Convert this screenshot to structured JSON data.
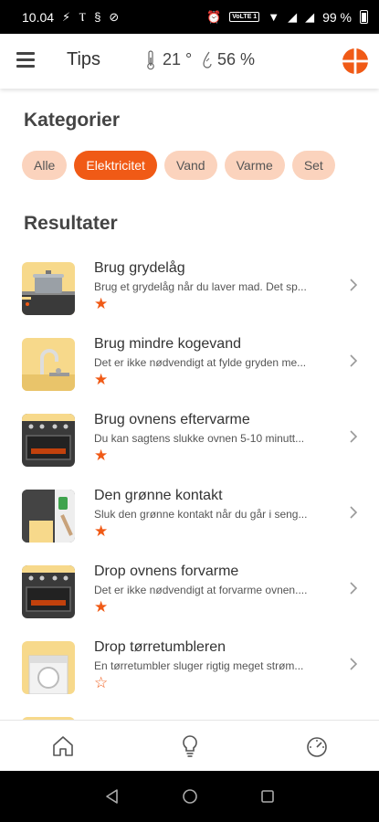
{
  "status_bar": {
    "time": "10.04",
    "volte": "VoLTE 1",
    "battery": "99 %"
  },
  "header": {
    "title": "Tips",
    "temperature": "21 °",
    "humidity": "56 %"
  },
  "categories": {
    "title": "Kategorier",
    "chips": [
      "Alle",
      "Elektricitet",
      "Vand",
      "Varme",
      "Set"
    ],
    "selected": "Elektricitet"
  },
  "results": {
    "title": "Resultater",
    "items": [
      {
        "title": "Brug grydelåg",
        "desc": "Brug et grydelåg når du laver mad. Det sp...",
        "starred": true,
        "icon": "pot-on-stove-icon"
      },
      {
        "title": "Brug mindre kogevand",
        "desc": "Det er ikke nødvendigt at fylde gryden me...",
        "starred": true,
        "icon": "water-faucet-icon"
      },
      {
        "title": "Brug ovnens eftervarme",
        "desc": "Du kan sagtens slukke ovnen 5-10 minutt...",
        "starred": true,
        "icon": "oven-icon"
      },
      {
        "title": "Den grønne kontakt",
        "desc": "Sluk den grønne kontakt når du går i seng...",
        "starred": true,
        "icon": "wall-switch-icon"
      },
      {
        "title": "Drop ovnens forvarme",
        "desc": "Det er ikke nødvendigt at forvarme ovnen....",
        "starred": true,
        "icon": "oven-icon"
      },
      {
        "title": "Drop tørretumbleren",
        "desc": "En tørretumbler sluger rigtig meget strøm...",
        "starred": false,
        "icon": "tumble-dryer-icon"
      }
    ]
  },
  "colors": {
    "accent": "#f05a16",
    "chip_bg": "#fbd3bd",
    "thumb_yellow": "#f7d98b"
  }
}
